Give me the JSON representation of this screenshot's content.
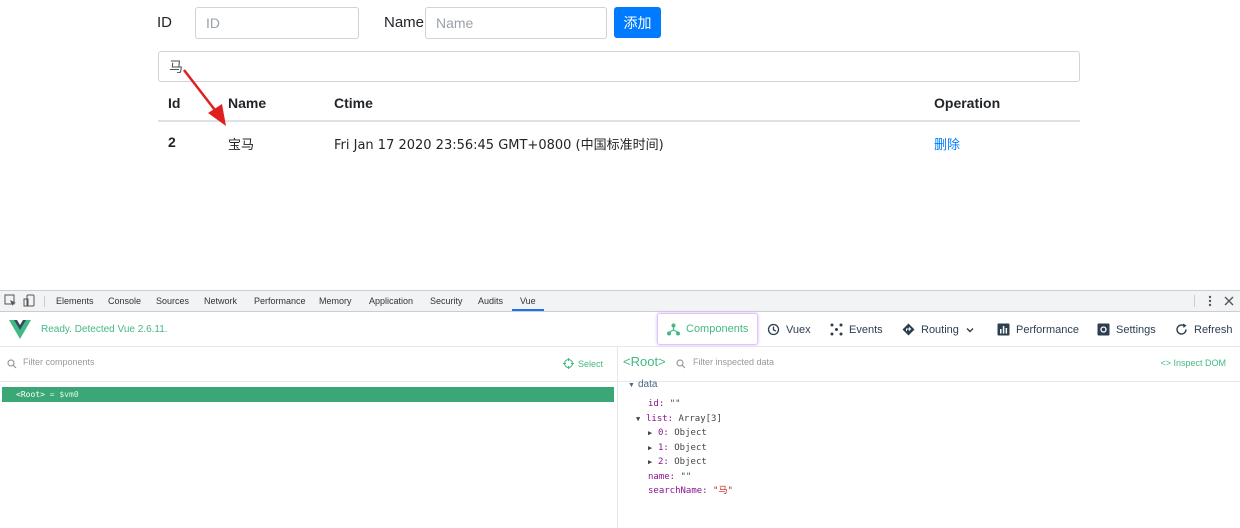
{
  "form": {
    "id_label": "ID",
    "id_placeholder": "ID",
    "id_value": "",
    "name_label": "Name",
    "name_placeholder": "Name",
    "name_value": "",
    "add_label": "添加"
  },
  "search": {
    "value": "马"
  },
  "table": {
    "headers": [
      "Id",
      "Name",
      "Ctime",
      "Operation"
    ],
    "rows": [
      {
        "id": "2",
        "name": "宝马",
        "ctime": "Fri Jan 17 2020 23:56:45 GMT+0800 (中国标准时间)",
        "operation": "删除"
      }
    ]
  },
  "devtools": {
    "tabs": [
      "Elements",
      "Console",
      "Sources",
      "Network",
      "Performance",
      "Memory",
      "Application",
      "Security",
      "Audits",
      "Vue"
    ],
    "active_tab": "Vue",
    "vue": {
      "status": "Ready. Detected Vue 2.6.11.",
      "nav": [
        "Components",
        "Vuex",
        "Events",
        "Routing",
        "Performance",
        "Settings",
        "Refresh"
      ],
      "active_nav": "Components",
      "filter_components_placeholder": "Filter components",
      "select_label": "Select",
      "root_label": "<Root>",
      "root_vm": "= $vm0",
      "inspect_title": "<Root>",
      "filter_data_placeholder": "Filter inspected data",
      "inspect_dom_label": "<> Inspect DOM",
      "data_section": "data",
      "data": {
        "id_key": "id:",
        "id_val": "\"\"",
        "list_key": "list:",
        "list_val": "Array[3]",
        "item0_key": "0:",
        "item0_val": "Object",
        "item1_key": "1:",
        "item1_val": "Object",
        "item2_key": "2:",
        "item2_val": "Object",
        "name_key": "name:",
        "name_val": "\"\"",
        "search_key": "searchName:",
        "search_val": "\"马\""
      }
    }
  },
  "colors": {
    "primary": "#007bff",
    "vue_green": "#42b983",
    "root_row": "#3ba776",
    "arrow": "#e02020"
  }
}
